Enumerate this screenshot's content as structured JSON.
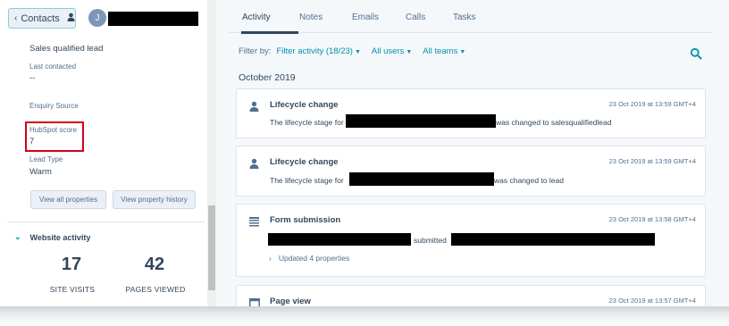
{
  "left_panel": {
    "contacts_button": "Contacts",
    "avatar_initial": "J",
    "properties": [
      {
        "label": "",
        "value": "Sales qualified lead"
      },
      {
        "label": "Last contacted",
        "value": "--"
      },
      {
        "label": "Enquiry Source",
        "value": ""
      },
      {
        "label": "HubSpot score",
        "value": "7"
      },
      {
        "label": "Lead Type",
        "value": "Warm"
      }
    ],
    "view_all_properties": "View all properties",
    "view_property_history": "View property history",
    "website_activity": {
      "title": "Website activity",
      "site_visits_value": "17",
      "site_visits_label": "SITE VISITS",
      "pages_viewed_value": "42",
      "pages_viewed_label": "PAGES VIEWED"
    }
  },
  "right_panel": {
    "tabs": [
      "Activity",
      "Notes",
      "Emails",
      "Calls",
      "Tasks"
    ],
    "active_tab": "Activity",
    "filter": {
      "label": "Filter by:",
      "activity": "Filter activity (18/23)",
      "users": "All users",
      "teams": "All teams"
    },
    "month": "October 2019",
    "cards": [
      {
        "icon": "person-icon",
        "title": "Lifecycle change",
        "time": "23 Oct 2019 at 13:59 GMT+4",
        "text_before": "The lifecycle stage for",
        "text_after": "was changed to salesqualifiedlead"
      },
      {
        "icon": "person-icon",
        "title": "Lifecycle change",
        "time": "23 Oct 2019 at 13:59 GMT+4",
        "text_before": "The lifecycle stage for",
        "text_after": "was changed to lead"
      },
      {
        "icon": "form-icon",
        "title": "Form submission",
        "time": "23 Oct 2019 at 13:58 GMT+4",
        "text_middle": "submitted",
        "updated": "Updated 4 properties"
      },
      {
        "icon": "page-view-icon",
        "title": "Page view",
        "time": "23 Oct 2019 at 13:57 GMT+4"
      }
    ]
  }
}
